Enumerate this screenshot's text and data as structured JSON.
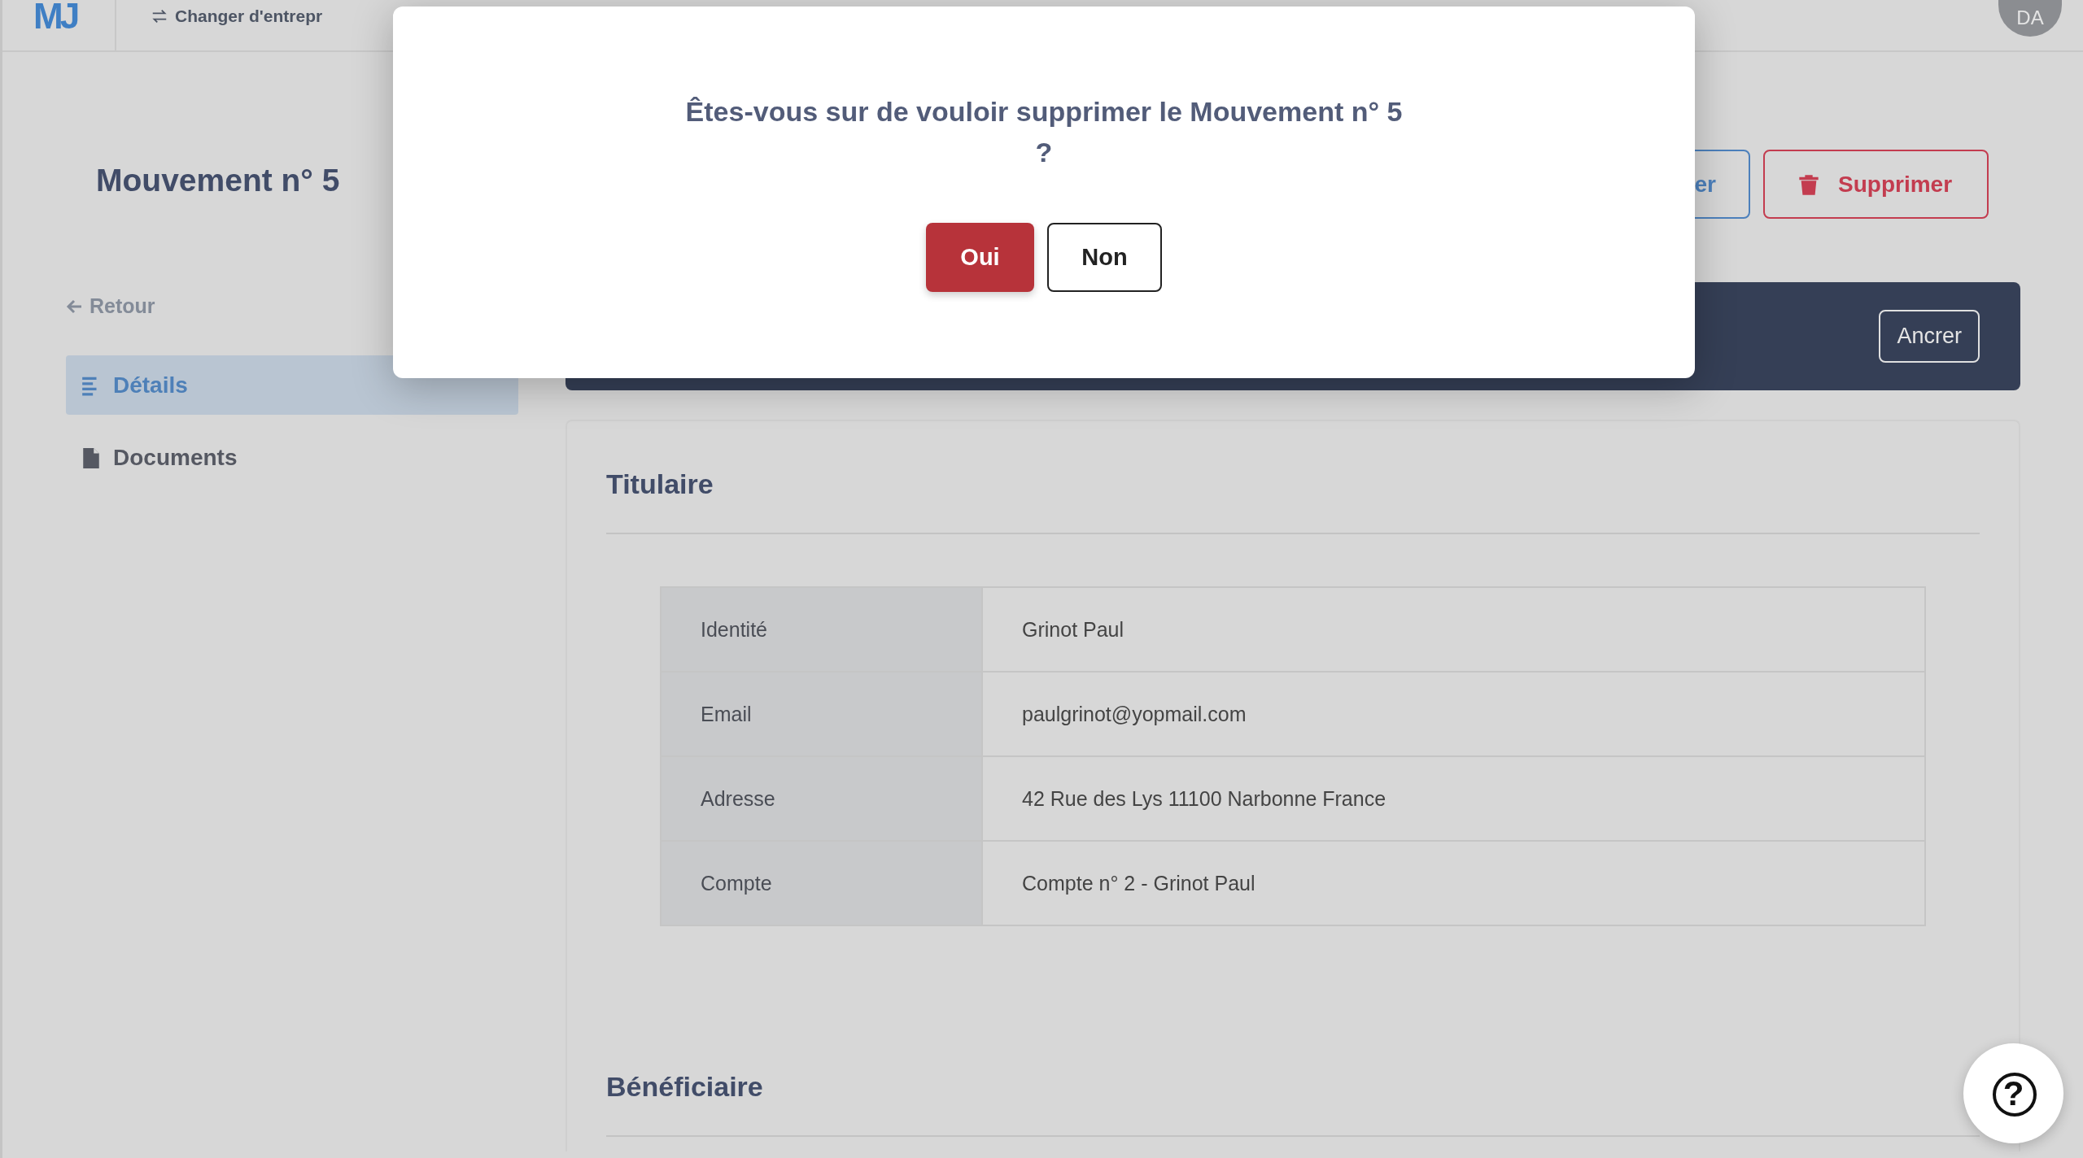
{
  "header": {
    "logo": "MJ",
    "switch_company": "Changer d'entrepr",
    "avatar": "DA"
  },
  "page": {
    "title": "Mouvement n° 5",
    "back": "Retour",
    "actions": [
      {
        "label": "er",
        "kind": "edit"
      },
      {
        "label": "Supprimer",
        "kind": "delete"
      }
    ]
  },
  "sidebar": {
    "items": [
      {
        "label": "Détails",
        "kind": "details",
        "selected": true
      },
      {
        "label": "Documents",
        "kind": "documents",
        "selected": false
      }
    ]
  },
  "banner": {
    "button": "Ancrer"
  },
  "sections": [
    {
      "title": "Titulaire",
      "rows": [
        {
          "label": "Identité",
          "value": "Grinot Paul"
        },
        {
          "label": "Email",
          "value": "paulgrinot@yopmail.com"
        },
        {
          "label": "Adresse",
          "value": "42 Rue des Lys 11100 Narbonne France"
        },
        {
          "label": "Compte",
          "value": "Compte n° 2 - Grinot Paul"
        }
      ]
    },
    {
      "title": "Bénéficiaire"
    }
  ],
  "dialog": {
    "message": "Êtes-vous sur de vouloir supprimer le Mouvement n° 5 ?",
    "buttons": [
      {
        "label": "Oui",
        "kind": "confirm"
      },
      {
        "label": "Non",
        "kind": "cancel"
      }
    ]
  },
  "help": {
    "label": "?"
  }
}
